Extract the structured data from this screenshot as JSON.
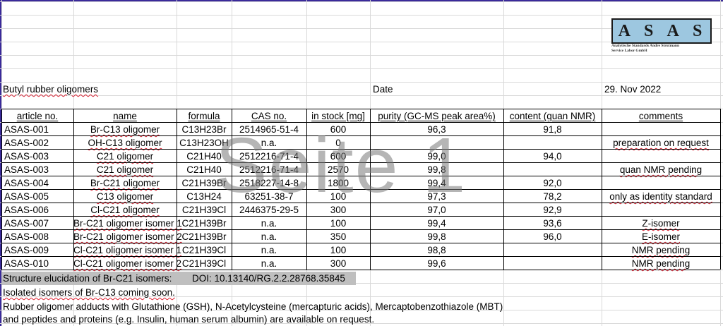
{
  "logo": {
    "letters": [
      "A",
      "S",
      "A",
      "S"
    ],
    "subtitle_line1": "Analytische Standards Andre Strutmann",
    "subtitle_line2": "Service Labor GmbH"
  },
  "heading": {
    "title": "Butyl rubber oligomers",
    "date_label": "Date",
    "date_value": "29. Nov 2022"
  },
  "watermark": "Seite 1",
  "columns": [
    "article no.",
    "name",
    "formula",
    "CAS no.",
    "in stock [mg]",
    "purity (GC-MS peak area%)",
    "content (quan NMR)",
    "comments"
  ],
  "rows": [
    [
      "ASAS-001",
      "Br-C13 oligomer",
      "C13H23Br",
      "2514965-51-4",
      "600",
      "96,3",
      "91,8",
      ""
    ],
    [
      "ASAS-002",
      "OH-C13 oligomer",
      "C13H23OH",
      "n.a.",
      "0",
      "",
      "",
      "preparation on request"
    ],
    [
      "ASAS-003",
      "C21 oligomer",
      "C21H40",
      "2512216-71-4",
      "600",
      "99,0",
      "94,0",
      ""
    ],
    [
      "ASAS-003",
      "C21 oligomer",
      "C21H40",
      "2512216-71-4",
      "2570",
      "99,8",
      "",
      "quan NMR pending"
    ],
    [
      "ASAS-004",
      "Br-C21 oligomer",
      "C21H39Br",
      "2518227-14-8",
      "1800",
      "99,4",
      "92,0",
      ""
    ],
    [
      "ASAS-005",
      "C13 oligomer",
      "C13H24",
      "63251-38-7",
      "100",
      "97,3",
      "78,2",
      "only as identity standard"
    ],
    [
      "ASAS-006",
      "Cl-C21 oligomer",
      "C21H39Cl",
      "2446375-29-5",
      "300",
      "97,0",
      "92,9",
      ""
    ],
    [
      "ASAS-007",
      "Br-C21 oligomer isomer 1",
      "C21H39Br",
      "n.a.",
      "100",
      "99,4",
      "93,6",
      "Z-isomer"
    ],
    [
      "ASAS-008",
      "Br-C21 oligomer isomer 2",
      "C21H39Br",
      "n.a.",
      "350",
      "99,8",
      "96,0",
      "E-isomer"
    ],
    [
      "ASAS-009",
      "Cl-C21 oligomer isomer 1",
      "C21H39Cl",
      "n.a.",
      "100",
      "98,8",
      "",
      "NMR pending"
    ],
    [
      "ASAS-010",
      "Cl-C21 oligomer isomer 2",
      "C21H39Cl",
      "n.a.",
      "300",
      "99,6",
      "",
      "NMR pending"
    ]
  ],
  "notes": {
    "structure_label": "Structure elucidation of Br-C21 isomers:",
    "structure_doi": "DOI: 10.13140/RG.2.2.28768.35845",
    "line2": "Isolated isomers of Br-C13 coming soon.",
    "line3": "Rubber oligomer adducts with Glutathione (GSH), N-Acetylcysteine (mercapturic acids), Mercaptobenzothiazole (MBT)",
    "line4": " and peptides and proteins (e.g. Insulin, human serum albumin) are available on request."
  }
}
